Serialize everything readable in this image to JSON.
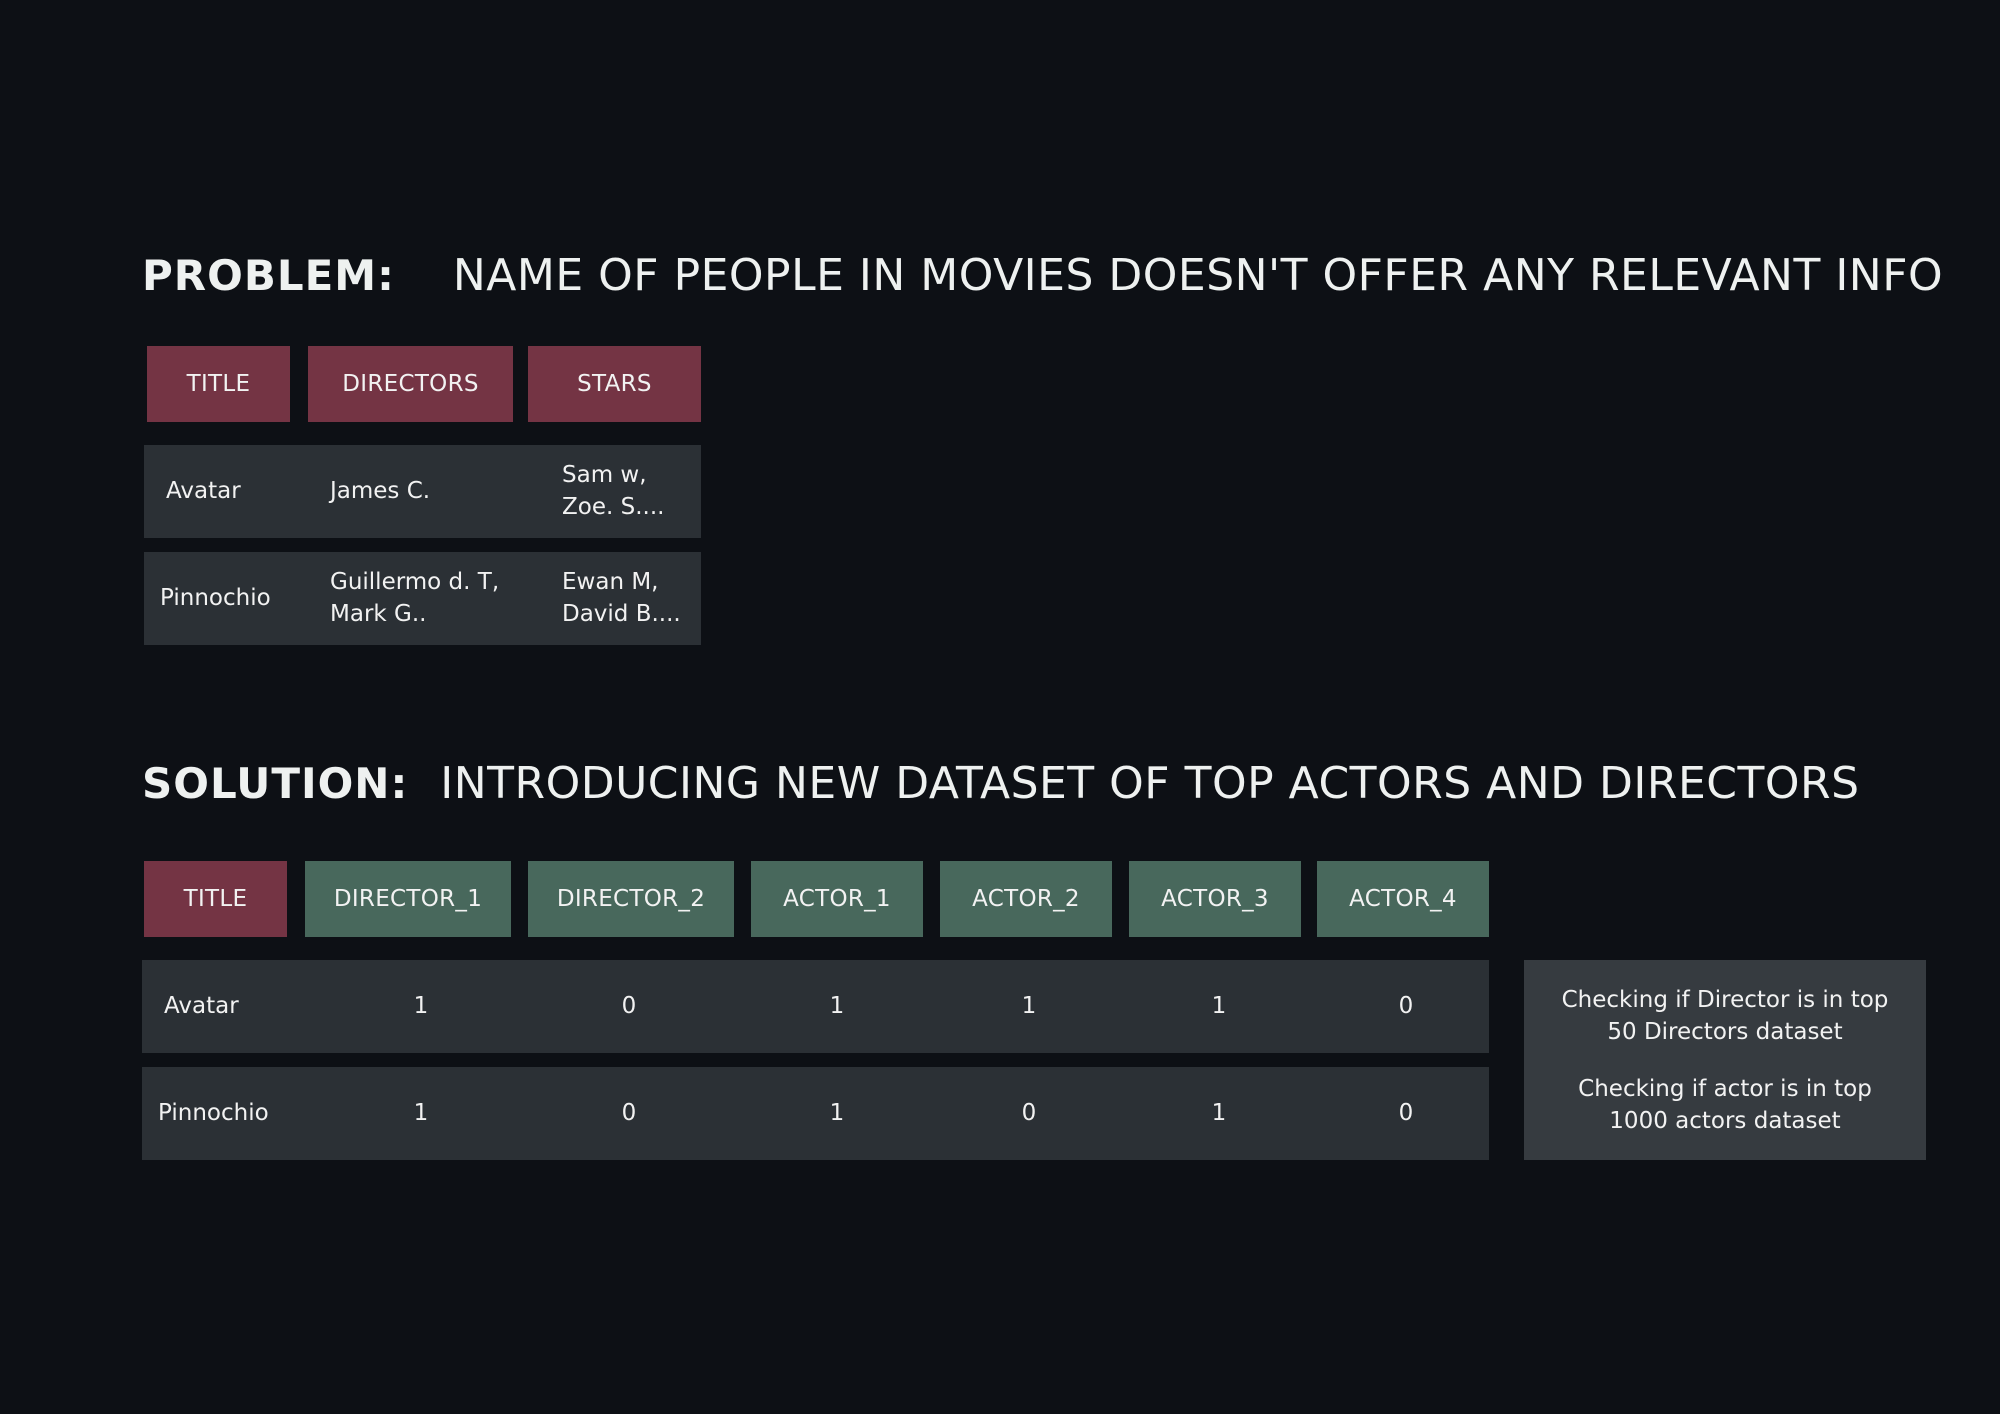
{
  "problem": {
    "keyword": "PROBLEM:",
    "text": "NAME OF PEOPLE IN MOVIES DOESN'T OFFER ANY RELEVANT INFO",
    "headers": [
      "TITLE",
      "DIRECTORS",
      "STARS"
    ],
    "rows": [
      {
        "title": "Avatar",
        "directors": [
          "James  C."
        ],
        "stars": [
          "Sam w,",
          "Zoe. S...."
        ]
      },
      {
        "title": "Pinnochio",
        "directors": [
          "Guillermo d. T,",
          "Mark G.."
        ],
        "stars": [
          "Ewan M,",
          "David B...."
        ]
      }
    ]
  },
  "solution": {
    "keyword": "SOLUTION:",
    "text": "INTRODUCING NEW DATASET OF TOP ACTORS AND DIRECTORS",
    "headers": [
      "TITLE",
      "DIRECTOR_1",
      "DIRECTOR_2",
      "ACTOR_1",
      "ACTOR_2",
      "ACTOR_3",
      "ACTOR_4"
    ],
    "rows": [
      {
        "title": "Avatar",
        "values": [
          "1",
          "0",
          "1",
          "1",
          "1",
          "0"
        ]
      },
      {
        "title": "Pinnochio",
        "values": [
          "1",
          "0",
          "1",
          "0",
          "1",
          "0"
        ]
      }
    ],
    "notes": [
      [
        "Checking if Director is in top",
        "50 Directors dataset"
      ],
      [
        "Checking if actor is in top",
        "1000 actors dataset"
      ]
    ]
  },
  "colors": {
    "background": "#0d1015",
    "header_red": "#743444",
    "header_green": "#48685c",
    "row_bg": "#2b3035",
    "note_bg": "#363b40"
  }
}
